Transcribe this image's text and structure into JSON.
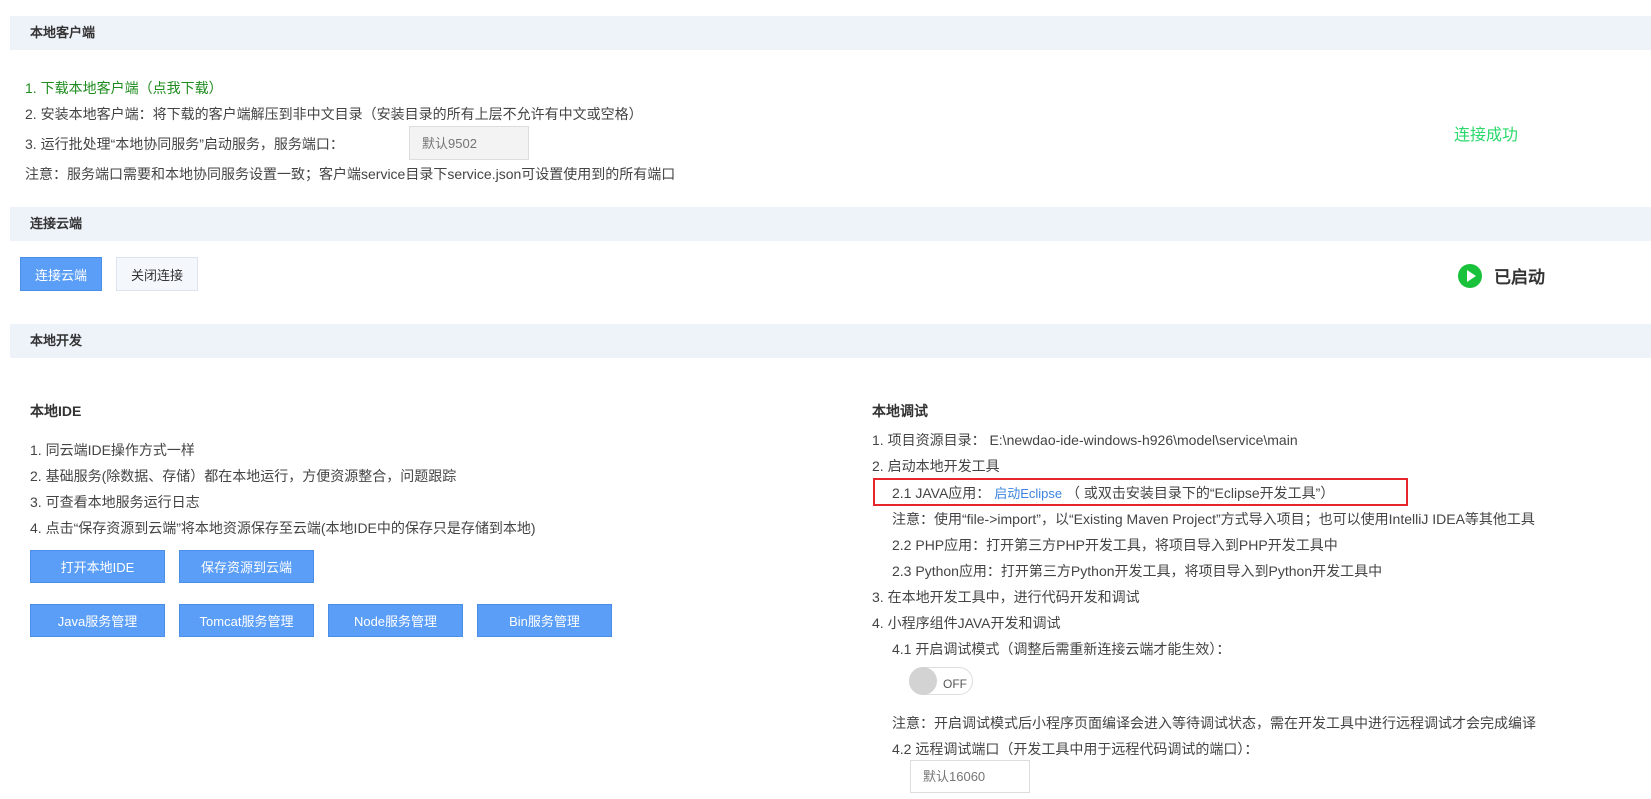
{
  "sections": {
    "local_client": "本地客户端",
    "connect_cloud": "连接云端",
    "local_dev": "本地开发"
  },
  "client": {
    "step1": "1. 下载本地客户端（点我下载）",
    "step2": "2. 安装本地客户端：将下载的客户端解压到非中文目录（安装目录的所有上层不允许有中文或空格）",
    "step3": "3. 运行批处理“本地协同服务”启动服务，服务端口：",
    "port_placeholder": "默认9502",
    "note": "注意：服务端口需要和本地协同服务设置一致；客户端service目录下service.json可设置使用到的所有端口",
    "status": "连接成功"
  },
  "cloud": {
    "connect_button": "连接云端",
    "disconnect_button": "关闭连接",
    "status": "已启动"
  },
  "ide": {
    "title": "本地IDE",
    "items": [
      "1. 同云端IDE操作方式一样",
      "2. 基础服务(除数据、存储）都在本地运行，方便资源整合，问题跟踪",
      "3. 可查看本地服务运行日志",
      "4. 点击“保存资源到云端”将本地资源保存至云端(本地IDE中的保存只是存储到本地)"
    ],
    "buttons": {
      "open_ide": "打开本地IDE",
      "save_cloud": "保存资源到云端",
      "java": "Java服务管理",
      "tomcat": "Tomcat服务管理",
      "node": "Node服务管理",
      "bin": "Bin服务管理"
    }
  },
  "debug": {
    "title": "本地调试",
    "step1": "1. 项目资源目录： E:\\newdao-ide-windows-h926\\model\\service\\main",
    "step2": "2. 启动本地开发工具",
    "java_prefix": "2.1 JAVA应用：",
    "eclipse_link": "启动Eclipse",
    "java_suffix": "（ 或双击安装目录下的“Eclipse开发工具”）",
    "note1": "注意：使用“file->import”，以“Existing Maven Project”方式导入项目；也可以使用IntelliJ IDEA等其他工具",
    "php": "2.2 PHP应用：打开第三方PHP开发工具，将项目导入到PHP开发工具中",
    "python": "2.3 Python应用：打开第三方Python开发工具，将项目导入到Python开发工具中",
    "step3": "3. 在本地开发工具中，进行代码开发和调试",
    "step4": "4. 小程序组件JAVA开发和调试",
    "step4_1": "4.1 开启调试模式（调整后需重新连接云端才能生效）：",
    "toggle_label": "OFF",
    "toggle_on": false,
    "note2": "注意：开启调试模式后小程序页面编译会进入等待调试状态，需在开发工具中进行远程调试才会完成编译",
    "step4_2": "4.2 远程调试端口（开发工具中用于远程代码调试的端口）：",
    "port_placeholder": "默认16060"
  }
}
